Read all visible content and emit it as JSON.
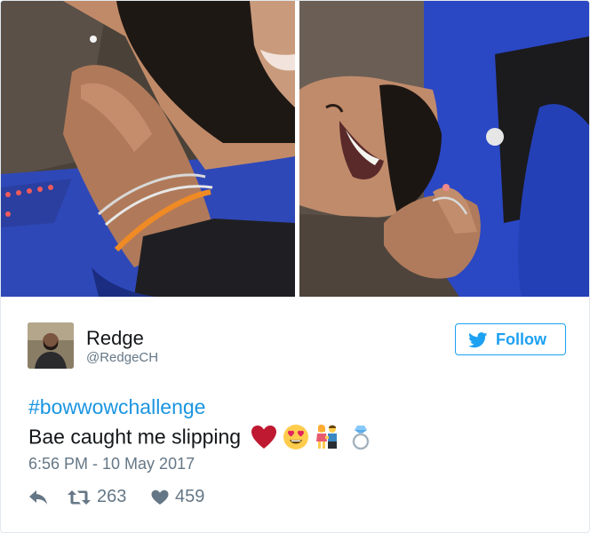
{
  "tweet": {
    "author": {
      "name": "Redge",
      "handle": "@RedgeCH"
    },
    "follow_button": {
      "label": "Follow",
      "icon": "twitter-bird-icon"
    },
    "hashtag": "#bowwowchallenge",
    "text": "Bae caught me slipping",
    "emojis": [
      "red-heart-icon",
      "heart-eyes-face-icon",
      "couple-holding-hands-icon",
      "ring-icon"
    ],
    "timestamp": "6:56 PM - 10 May 2017",
    "actions": {
      "reply": {
        "icon": "reply-arrow-icon"
      },
      "retweet": {
        "icon": "retweet-icon",
        "count": "263"
      },
      "like": {
        "icon": "heart-icon",
        "count": "459"
      }
    },
    "colors": {
      "link": "#1b95e0",
      "follow_blue": "#1da1f2",
      "muted_gray": "#657786",
      "text": "#14171a",
      "like_red": "#e0245e"
    }
  }
}
